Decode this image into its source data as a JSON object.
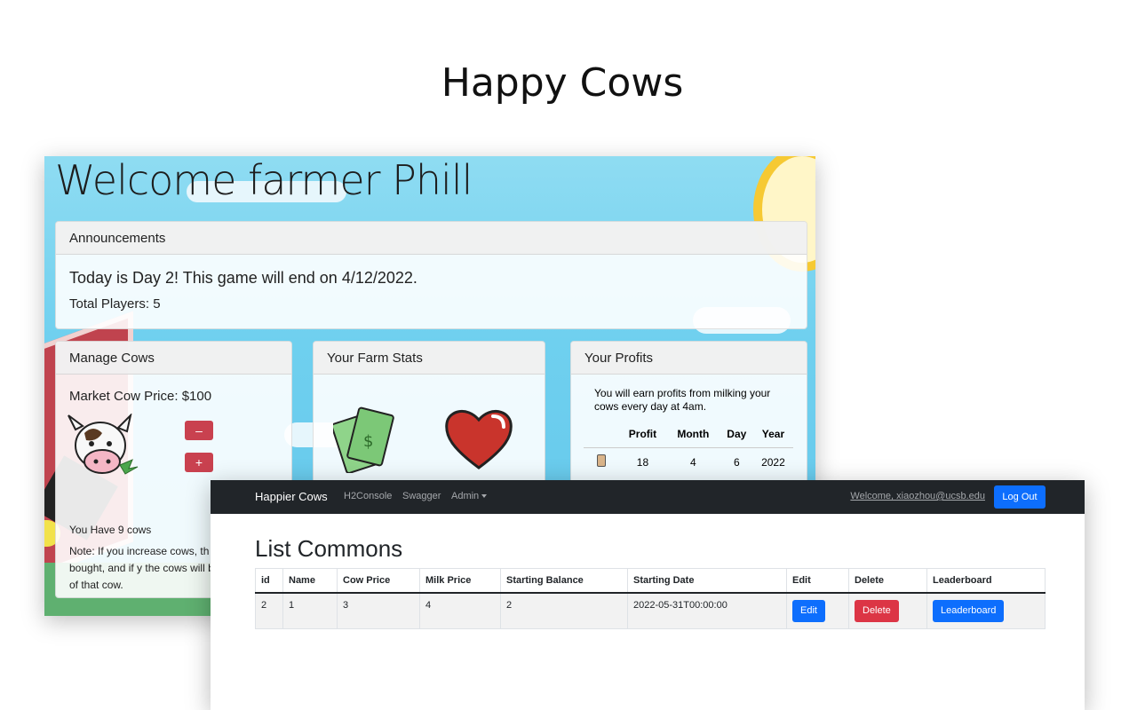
{
  "title": "Happy Cows",
  "farm": {
    "welcome": "Welcome farmer Phill",
    "announcements": {
      "header": "Announcements",
      "day_text": "Today is Day 2! This game will end on 4/12/2022.",
      "players_text": "Total Players: 5"
    },
    "manage_cows": {
      "header": "Manage Cows",
      "market_price": "Market Cow Price: $100",
      "minus_label": "–",
      "plus_label": "+",
      "cow_count": "You Have 9 cows",
      "note": "Note: If you increase cows, th automatically bought, and if y the cows will be sold for pric of that cow."
    },
    "farm_stats": {
      "header": "Your Farm Stats"
    },
    "profits": {
      "header": "Your Profits",
      "description": "You will earn profits from milking your cows every day at 4am.",
      "columns": [
        "Profit",
        "Month",
        "Day",
        "Year"
      ],
      "rows": [
        [
          "18",
          "4",
          "6",
          "2022"
        ]
      ]
    }
  },
  "admin": {
    "navbar": {
      "brand": "Happier Cows",
      "links": [
        "H2Console",
        "Swagger",
        "Admin"
      ],
      "welcome": "Welcome, xiaozhou@ucsb.edu",
      "logout": "Log Out"
    },
    "page_title": "List Commons",
    "table": {
      "columns": [
        "id",
        "Name",
        "Cow Price",
        "Milk Price",
        "Starting Balance",
        "Starting Date",
        "Edit",
        "Delete",
        "Leaderboard"
      ],
      "rows": [
        {
          "id": "2",
          "name": "1",
          "cow_price": "3",
          "milk_price": "4",
          "starting_balance": "2",
          "starting_date": "2022-05-31T00:00:00",
          "edit": "Edit",
          "delete": "Delete",
          "leaderboard": "Leaderboard"
        }
      ]
    }
  },
  "colors": {
    "primary": "#0d6efd",
    "danger": "#dc3545",
    "navbar": "#212529",
    "sky": "#6fd0ef"
  }
}
